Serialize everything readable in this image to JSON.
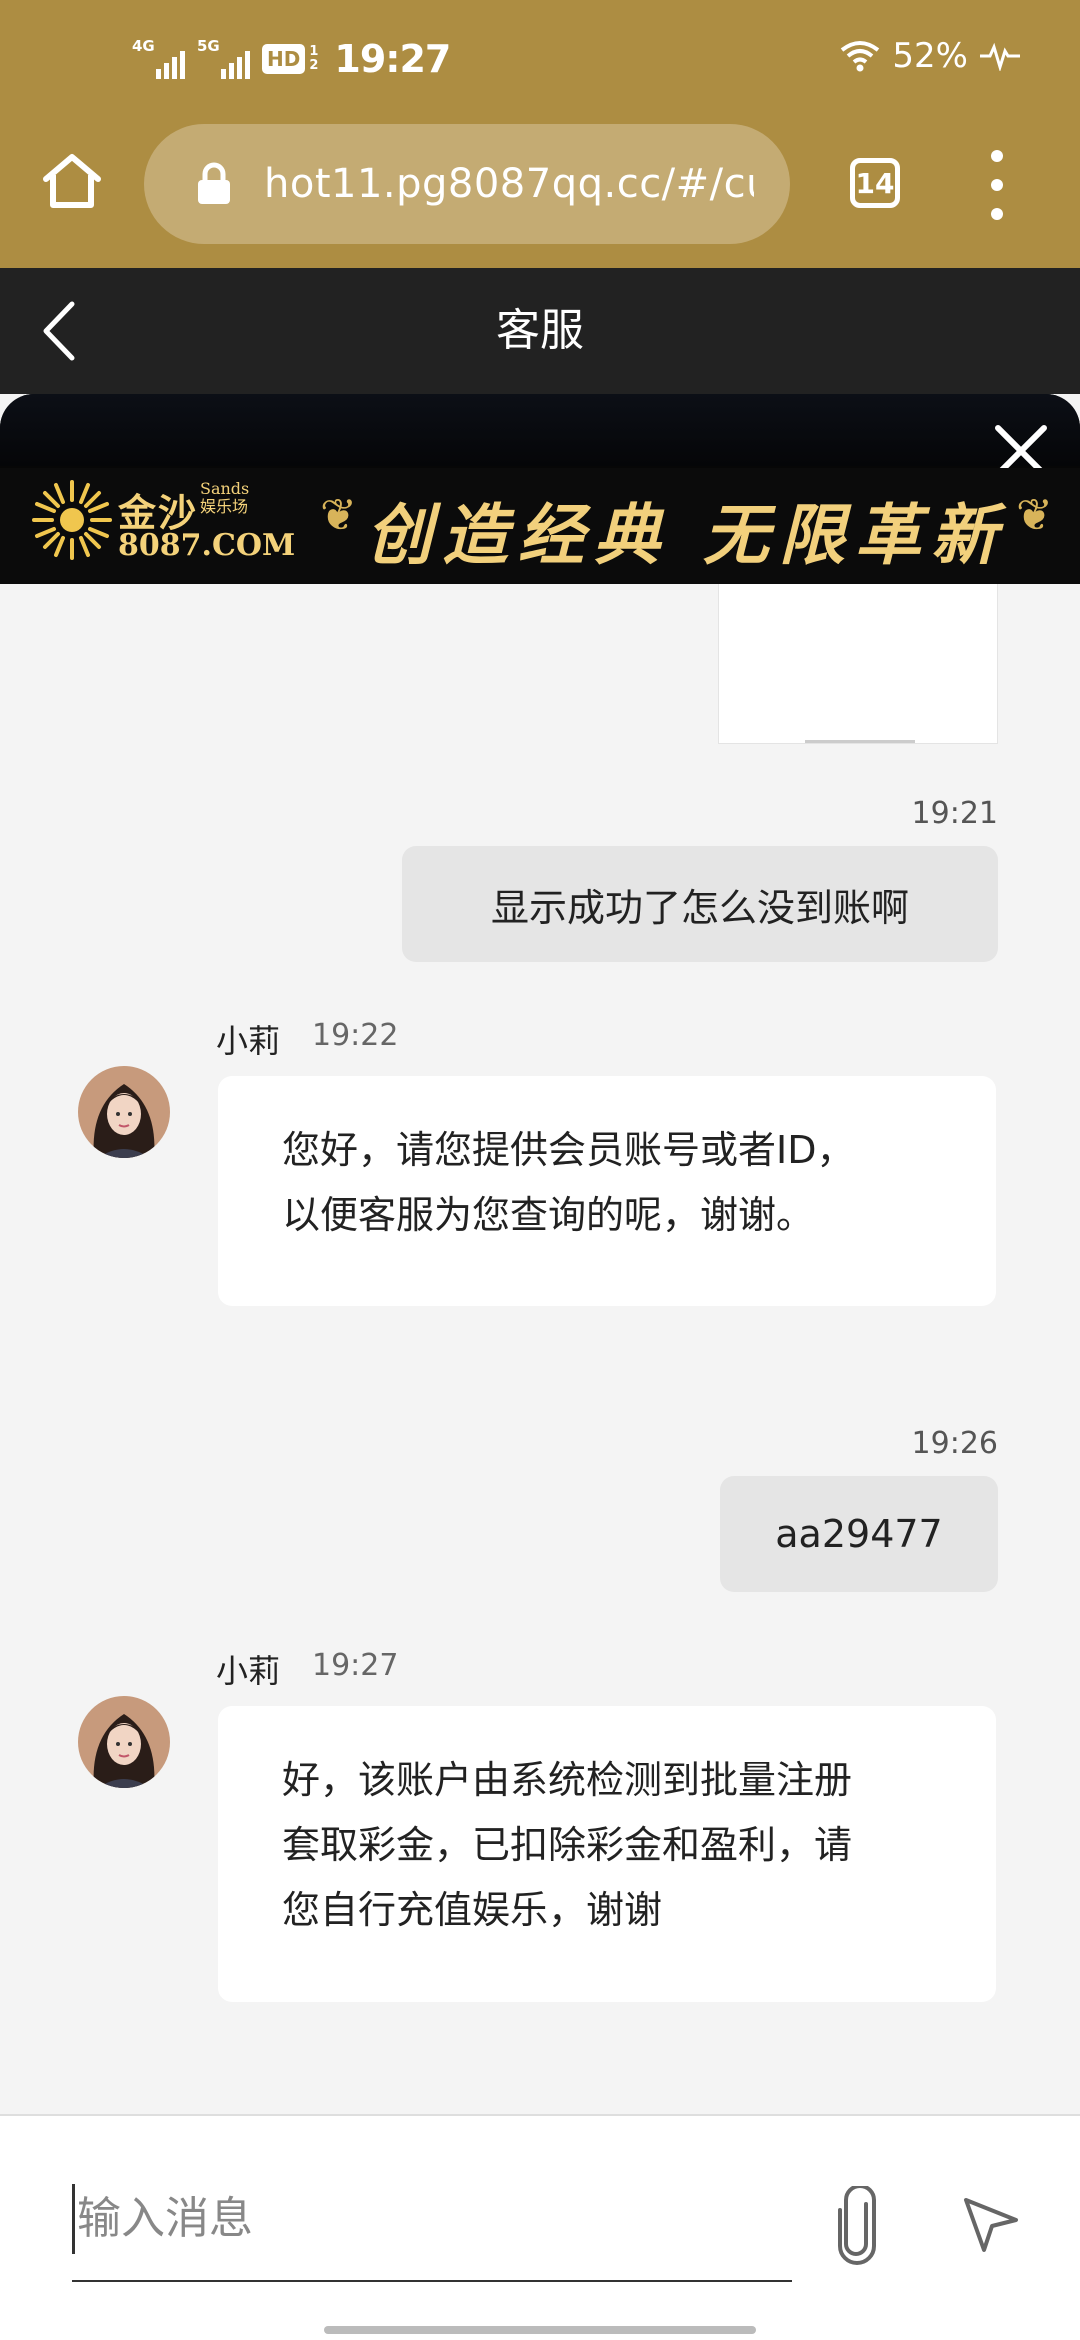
{
  "status_bar": {
    "signal_1_label": "4G",
    "signal_2_label": "5G",
    "hd_label": "HD",
    "hd_sub_1": "1",
    "hd_sub_2": "2",
    "time": "19:27",
    "battery": "52%"
  },
  "browser": {
    "url": "hot11.pg8087qq.cc/#/cu",
    "tab_count": "14"
  },
  "header": {
    "title": "客服"
  },
  "banner": {
    "brand_name": "金沙",
    "brand_sub_1": "Sands",
    "brand_sub_2": "娱乐场",
    "brand_url": "8087.COM",
    "slogan": "创造经典 无限革新"
  },
  "messages": [
    {
      "direction": "out",
      "time": "19:21",
      "text": "显示成功了怎么没到账啊"
    },
    {
      "direction": "in",
      "sender": "小莉",
      "time": "19:22",
      "lines": [
        "您好，请您提供会员账号或者ID，",
        "以便客服为您查询的呢，谢谢。"
      ]
    },
    {
      "direction": "out",
      "time": "19:26",
      "text": "aa29477"
    },
    {
      "direction": "in",
      "sender": "小莉",
      "time": "19:27",
      "lines": [
        "好，该账户由系统检测到批量注册",
        "套取彩金，已扣除彩金和盈利，请",
        "您自行充值娱乐，谢谢"
      ]
    }
  ],
  "input": {
    "placeholder": "输入消息"
  },
  "colors": {
    "browser_bar": "#ad8d42",
    "header": "#222222",
    "outgoing_bubble": "#e5e5e5",
    "incoming_bubble": "#ffffff",
    "banner_gold": "#f2d07c"
  },
  "icons": [
    "home-icon",
    "lock-icon",
    "more-icon",
    "back-icon",
    "close-icon",
    "paperclip-icon",
    "send-icon",
    "wifi-icon"
  ]
}
